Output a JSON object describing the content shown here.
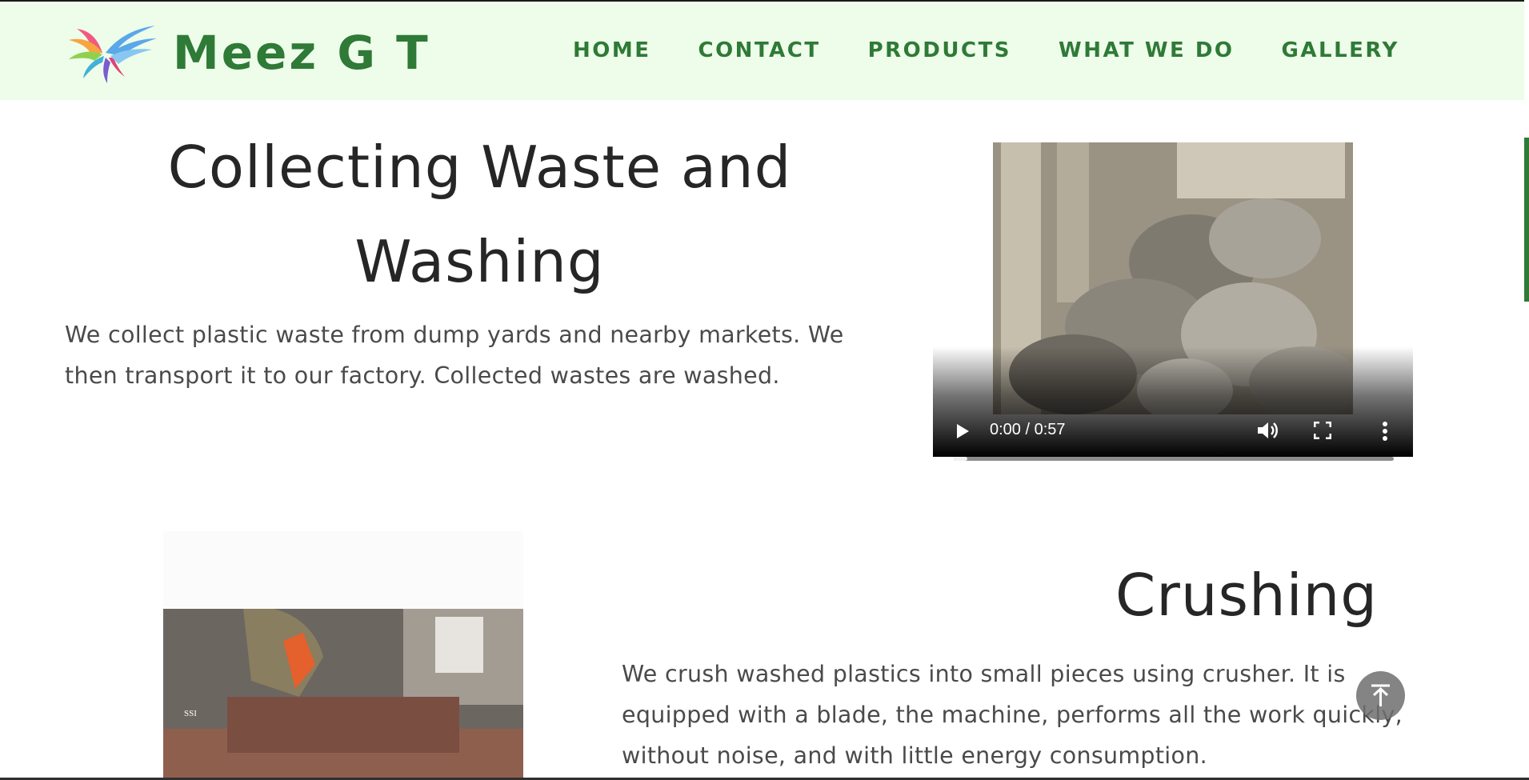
{
  "header": {
    "brand": "Meez G T",
    "logo_icon": "bird-logo-icon",
    "nav": [
      "HOME",
      "CONTACT",
      "PRODUCTS",
      "WHAT WE DO",
      "GALLERY"
    ]
  },
  "section1": {
    "title_line1": "Collecting Waste and",
    "title_line2": "Washing",
    "text": "We collect plastic waste from dump yards and nearby markets. We then transport it to our factory. Collected wastes are washed.",
    "video": {
      "time": "0:00 / 0:57",
      "progress": 0.03,
      "icons": [
        "play-icon",
        "volume-icon",
        "fullscreen-icon",
        "more-options-icon"
      ]
    }
  },
  "section2": {
    "title": "Crushing",
    "text": "We crush washed plastics into small pieces using crusher. It is equipped with a blade, the machine, performs all the work quickly, without noise, and with little energy consumption.",
    "image_watermark": "SSI"
  },
  "colors": {
    "brand_green": "#2e7a36",
    "header_bg": "#eefcea"
  },
  "scroll_top_icon": "arrow-up-to-top-icon"
}
